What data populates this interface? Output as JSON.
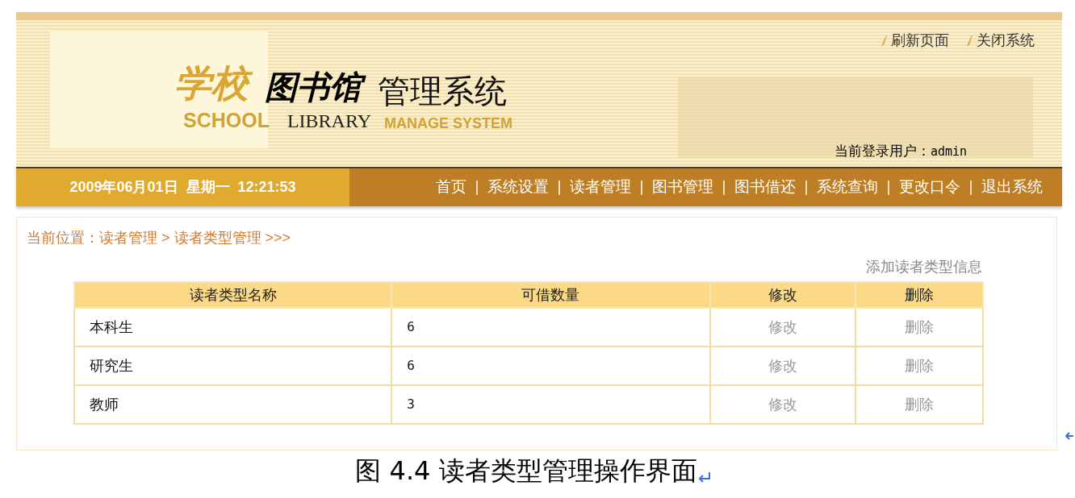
{
  "header": {
    "logo": {
      "school_cn": "学校",
      "library_cn": "图书馆",
      "manage_cn": "管理系统",
      "school_en": "SCHOOL",
      "library_en": "LIBRARY",
      "manage_en": "MANAGE SYSTEM"
    },
    "links": [
      "刷新页面",
      "关闭系统"
    ],
    "current_user_label": "当前登录用户：",
    "current_user": "admin"
  },
  "nav": {
    "datetime": "2009年06月01日  星期一  12:21:53",
    "items": [
      "首页",
      "系统设置",
      "读者管理",
      "图书管理",
      "图书借还",
      "系统查询",
      "更改口令",
      "退出系统"
    ]
  },
  "breadcrumb": "当前位置：读者管理 > 读者类型管理 >>>",
  "add_link": "添加读者类型信息",
  "table": {
    "columns": [
      "读者类型名称",
      "可借数量",
      "修改",
      "删除"
    ],
    "rows": [
      {
        "name": "本科生",
        "count": "6",
        "edit": "修改",
        "delete": "删除"
      },
      {
        "name": "研究生",
        "count": "6",
        "edit": "修改",
        "delete": "删除"
      },
      {
        "name": "教师",
        "count": "3",
        "edit": "修改",
        "delete": "删除"
      }
    ]
  },
  "caption": "图 4.4 读者类型管理操作界面"
}
